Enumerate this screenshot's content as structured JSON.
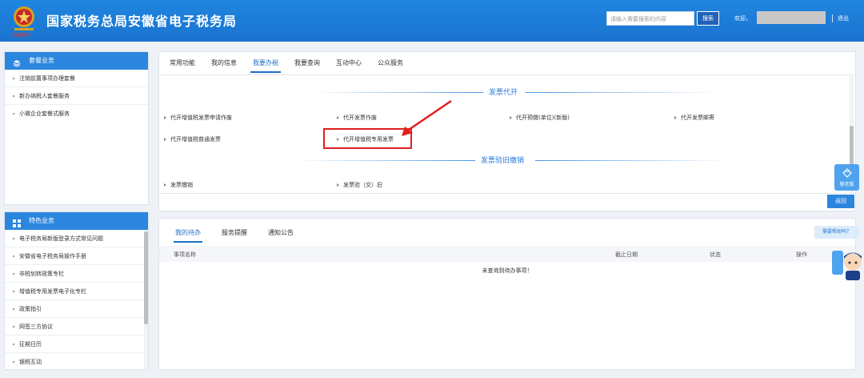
{
  "header": {
    "emblem_caption": "中国税务",
    "title": "国家税务总局安徽省电子税务局",
    "search_placeholder": "请输入需要搜索的内容",
    "search_button": "搜索",
    "welcome": "欢迎，",
    "logout": "退出"
  },
  "sidebar": {
    "package": {
      "title": "套餐业务",
      "items": [
        "注销前置事项办理套餐",
        "新办纳税人套餐服务",
        "小微企业套餐式服务"
      ]
    },
    "special": {
      "title": "特色业务",
      "items": [
        "电子税务局新版登录方式常见问题",
        "安徽省电子税务局操作手册",
        "非税划转政策专栏",
        "增值税专用发票电子化专栏",
        "政策指引",
        "网签三方协议",
        "征期日历",
        "银税互动"
      ]
    }
  },
  "main": {
    "tabs": [
      "常用功能",
      "我的信息",
      "我要办税",
      "我要查询",
      "互动中心",
      "公众服务"
    ],
    "active_tab": "我要办税",
    "section1": {
      "title": "发票代开",
      "links": [
        "代开增值税发票申请作废",
        "代开发票作废",
        "代开预缴(单位)(新版)",
        "代开发票邮寄",
        "代开增值税普通发票",
        "代开增值税专用发票"
      ]
    },
    "section2": {
      "title": "发票验旧缴销",
      "links": [
        "发票缴销",
        "发票验（交）旧"
      ]
    },
    "back_button": "返回",
    "elder_button": "敬老版"
  },
  "bottom": {
    "tabs": [
      "我的待办",
      "服务提醒",
      "通知公告"
    ],
    "active_tab": "我的待办",
    "help": "需要帮助吗？",
    "columns": [
      "事项名称",
      "截止日期",
      "状态",
      "操作"
    ],
    "empty_text": "未查询到待办事项！"
  },
  "colors": {
    "brand_blue": "#1a73cf",
    "accent_blue": "#2c86de",
    "highlight_red": "#e02020"
  }
}
